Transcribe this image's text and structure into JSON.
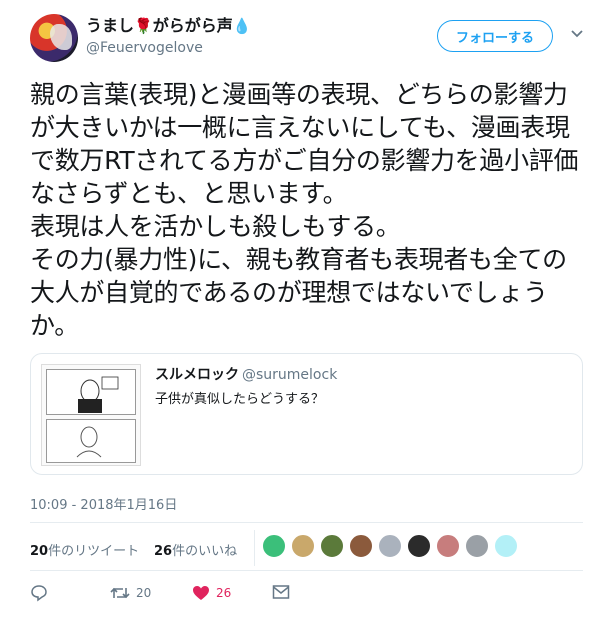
{
  "user": {
    "display_name": "うまし",
    "display_name_suffix": "がらがら声",
    "handle": "@Feuervogelove"
  },
  "follow_label": "フォローする",
  "tweet": {
    "text": "親の言葉(表現)と漫画等の表現、どちらの影響力が大きいかは一概に言えないにしても、漫画表現で数万RTされてる方がご自分の影響力を過小評価なさらずとも、と思います。\n表現は人を活かしも殺しもする。\nその力(暴力性)に、親も教育者も表現者も全ての大人が自覚的であるのが理想ではないでしょうか。",
    "timestamp": "10:09 - 2018年1月16日"
  },
  "quote": {
    "name": "スルメロック",
    "handle": "@surumelock",
    "text": "子供が真似したらどうする？"
  },
  "stats": {
    "retweets_count": "20",
    "retweets_label": "件のリツイート",
    "likes_count": "26",
    "likes_label": "件のいいね",
    "liker_colors": [
      "#3bbf7a",
      "#c9a86b",
      "#5b7a3a",
      "#8b5a3c",
      "#aab2bd",
      "#2b2b2b",
      "#c77d7d",
      "#9aa0a6",
      "#b3f0f7"
    ]
  },
  "actions": {
    "reply_icon": "reply-icon",
    "retweet_count": "20",
    "like_count": "26",
    "dm_icon": "envelope-icon"
  },
  "colors": {
    "accent": "#1da1f2",
    "like": "#e0245e",
    "secondary_text": "#657786"
  }
}
